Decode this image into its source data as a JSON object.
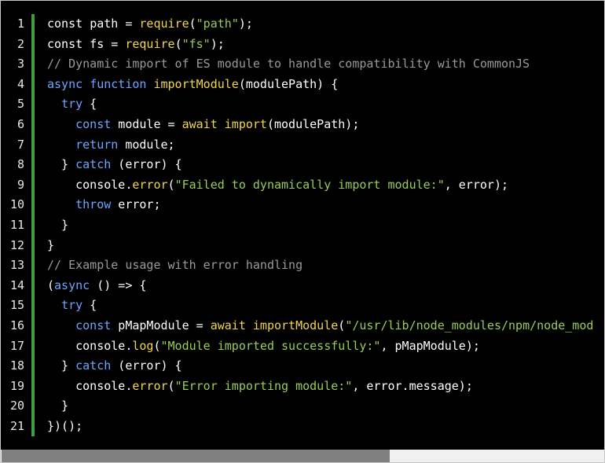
{
  "code": {
    "lines": [
      {
        "n": "1",
        "t": [
          [
            "p",
            "const "
          ],
          [
            "k",
            ""
          ],
          [
            "p",
            "path = "
          ],
          [
            "f",
            "require"
          ],
          [
            "p",
            "("
          ],
          [
            "s",
            "\"path\""
          ],
          [
            "p",
            ");"
          ]
        ]
      },
      {
        "n": "2",
        "t": [
          [
            "p",
            "const fs = "
          ],
          [
            "f",
            "require"
          ],
          [
            "p",
            "("
          ],
          [
            "s",
            "\"fs\""
          ],
          [
            "p",
            ");"
          ]
        ]
      },
      {
        "n": "3",
        "t": [
          [
            "c",
            "// Dynamic import of ES module to handle compatibility with CommonJS"
          ]
        ]
      },
      {
        "n": "4",
        "t": [
          [
            "k",
            "async"
          ],
          [
            "p",
            " "
          ],
          [
            "k",
            "function"
          ],
          [
            "p",
            " "
          ],
          [
            "f",
            "importModule"
          ],
          [
            "p",
            "(modulePath) {"
          ]
        ]
      },
      {
        "n": "5",
        "t": [
          [
            "p",
            "  "
          ],
          [
            "k",
            "try"
          ],
          [
            "p",
            " {"
          ]
        ]
      },
      {
        "n": "6",
        "t": [
          [
            "p",
            "    "
          ],
          [
            "k",
            "const"
          ],
          [
            "p",
            " module = "
          ],
          [
            "f",
            "await"
          ],
          [
            "p",
            " "
          ],
          [
            "f",
            "import"
          ],
          [
            "p",
            "(modulePath);"
          ]
        ]
      },
      {
        "n": "7",
        "t": [
          [
            "p",
            "    "
          ],
          [
            "k",
            "return"
          ],
          [
            "p",
            " module;"
          ]
        ]
      },
      {
        "n": "8",
        "t": [
          [
            "p",
            "  } "
          ],
          [
            "k",
            "catch"
          ],
          [
            "p",
            " (error) {"
          ]
        ]
      },
      {
        "n": "9",
        "t": [
          [
            "p",
            "    console."
          ],
          [
            "f",
            "error"
          ],
          [
            "p",
            "("
          ],
          [
            "s",
            "\"Failed to dynamically import module:\""
          ],
          [
            "p",
            ", error);"
          ]
        ]
      },
      {
        "n": "10",
        "t": [
          [
            "p",
            "    "
          ],
          [
            "k",
            "throw"
          ],
          [
            "p",
            " error;"
          ]
        ]
      },
      {
        "n": "11",
        "t": [
          [
            "p",
            "  }"
          ]
        ]
      },
      {
        "n": "12",
        "t": [
          [
            "p",
            "}"
          ]
        ]
      },
      {
        "n": "13",
        "t": [
          [
            "c",
            "// Example usage with error handling"
          ]
        ]
      },
      {
        "n": "14",
        "t": [
          [
            "p",
            "("
          ],
          [
            "k",
            "async"
          ],
          [
            "p",
            " () => {"
          ]
        ]
      },
      {
        "n": "15",
        "t": [
          [
            "p",
            "  "
          ],
          [
            "k",
            "try"
          ],
          [
            "p",
            " {"
          ]
        ]
      },
      {
        "n": "16",
        "t": [
          [
            "p",
            "    "
          ],
          [
            "k",
            "const"
          ],
          [
            "p",
            " pMapModule = "
          ],
          [
            "f",
            "await"
          ],
          [
            "p",
            " "
          ],
          [
            "f",
            "importModule"
          ],
          [
            "p",
            "("
          ],
          [
            "s",
            "\"/usr/lib/node_modules/npm/node_mod"
          ]
        ]
      },
      {
        "n": "17",
        "t": [
          [
            "p",
            "    console."
          ],
          [
            "f",
            "log"
          ],
          [
            "p",
            "("
          ],
          [
            "s",
            "\"Module imported successfully:\""
          ],
          [
            "p",
            ", pMapModule);"
          ]
        ]
      },
      {
        "n": "18",
        "t": [
          [
            "p",
            "  } "
          ],
          [
            "k",
            "catch"
          ],
          [
            "p",
            " (error) {"
          ]
        ]
      },
      {
        "n": "19",
        "t": [
          [
            "p",
            "    console."
          ],
          [
            "f",
            "error"
          ],
          [
            "p",
            "("
          ],
          [
            "s",
            "\"Error importing module:\""
          ],
          [
            "p",
            ", error.message);"
          ]
        ]
      },
      {
        "n": "20",
        "t": [
          [
            "p",
            "  }"
          ]
        ]
      },
      {
        "n": "21",
        "t": [
          [
            "p",
            "})();"
          ]
        ]
      }
    ]
  },
  "colors": {
    "background": "#000000",
    "gutter_bar": "#3f9e3f",
    "keyword": "#6ea6ff",
    "function": "#f2d648",
    "string": "#9acd55",
    "comment": "#9a9a9a",
    "plain": "#ffffff"
  },
  "scrollbar": {
    "position_fraction": 0.0,
    "visible_fraction": 0.64
  }
}
